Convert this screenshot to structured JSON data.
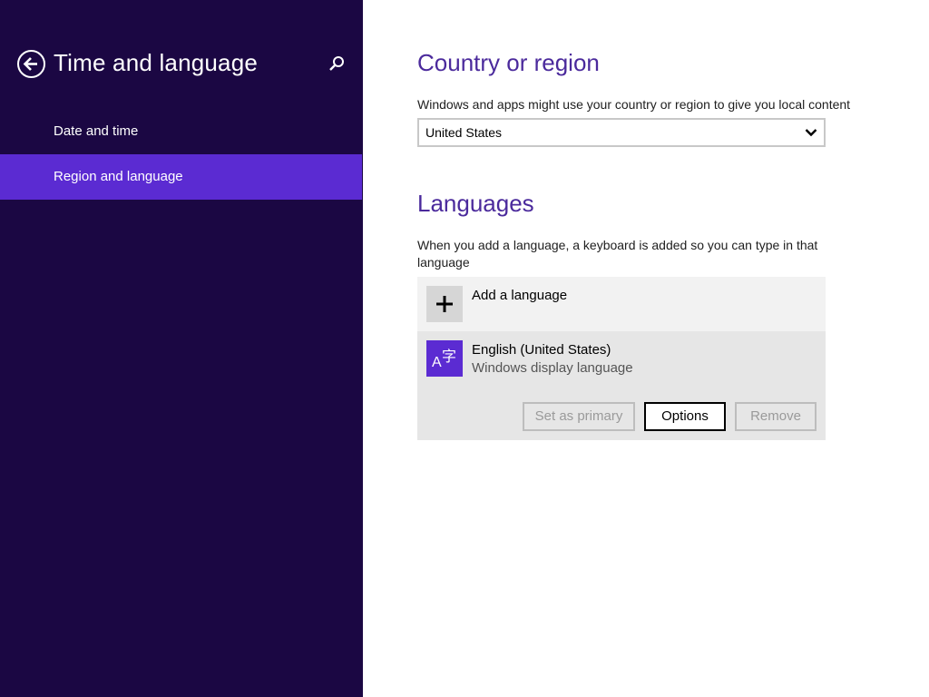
{
  "sidebar": {
    "title": "Time and language",
    "items": [
      {
        "label": "Date and time",
        "selected": false
      },
      {
        "label": "Region and language",
        "selected": true
      }
    ],
    "background": "#1b0743",
    "selected_color": "#5b2bd2"
  },
  "country": {
    "heading": "Country or region",
    "description": "Windows and apps might use your country or region to give you local content",
    "selected_value": "United States"
  },
  "languages": {
    "heading": "Languages",
    "description": "When you add a language, a keyboard is added so you can type in that language",
    "add_label": "Add a language",
    "installed": [
      {
        "name": "English (United States)",
        "subtitle": "Windows display language",
        "tile_glyph_latin": "A",
        "tile_glyph_cjk": "字"
      }
    ],
    "buttons": {
      "set_primary": "Set as primary",
      "options": "Options",
      "remove": "Remove"
    }
  },
  "icons": {
    "back": "back-arrow-icon",
    "search": "search-icon",
    "chevron": "chevron-down-icon",
    "plus": "plus-icon",
    "language": "language-icon"
  },
  "accent_color": "#4b2a9c"
}
